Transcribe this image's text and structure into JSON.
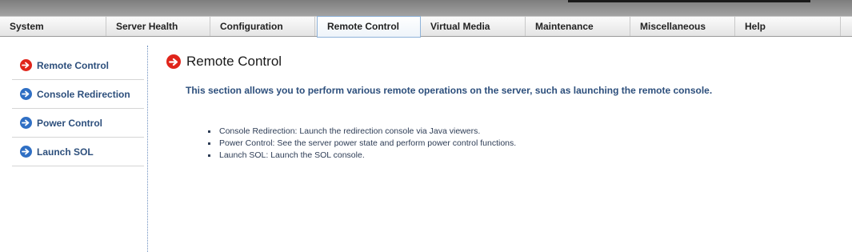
{
  "nav": {
    "items": [
      {
        "label": "System",
        "active": false
      },
      {
        "label": "Server Health",
        "active": false
      },
      {
        "label": "Configuration",
        "active": false
      },
      {
        "label": "Remote Control",
        "active": true
      },
      {
        "label": "Virtual Media",
        "active": false
      },
      {
        "label": "Maintenance",
        "active": false
      },
      {
        "label": "Miscellaneous",
        "active": false
      },
      {
        "label": "Help",
        "active": false
      }
    ]
  },
  "sidebar": {
    "items": [
      {
        "label": "Remote Control",
        "icon": "arrow-right-circle-icon",
        "color": "#e0251b"
      },
      {
        "label": "Console Redirection",
        "icon": "arrow-right-circle-icon",
        "color": "#2f6fc4"
      },
      {
        "label": "Power Control",
        "icon": "arrow-right-circle-icon",
        "color": "#2f6fc4"
      },
      {
        "label": "Launch SOL",
        "icon": "arrow-right-circle-icon",
        "color": "#2f6fc4"
      }
    ]
  },
  "main": {
    "title": "Remote Control",
    "intro": "This section allows you to perform various remote operations on the server, such as launching the remote console.",
    "bullets": [
      "Console Redirection: Launch the redirection console via Java viewers.",
      "Power Control: See the server power state and perform power control functions.",
      "Launch SOL: Launch the SOL console."
    ]
  },
  "colors": {
    "accent_red": "#e0251b",
    "accent_blue": "#2f6fc4",
    "link_text": "#2d4f7c"
  }
}
